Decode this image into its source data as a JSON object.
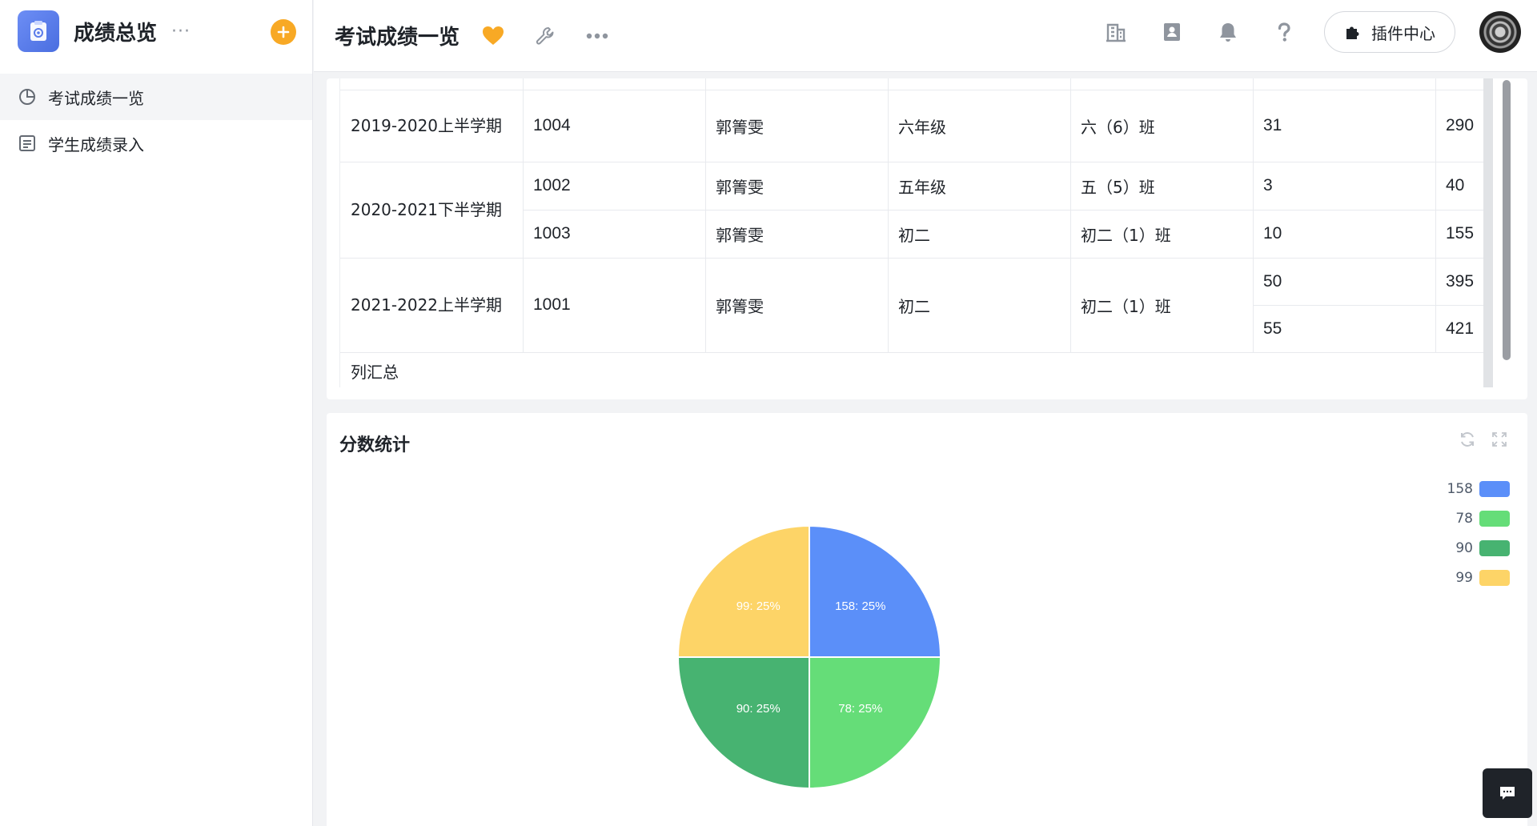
{
  "sidebar": {
    "app_name": "成绩总览",
    "more": "···",
    "items": [
      {
        "label": "考试成绩一览",
        "icon": "clock-pie-icon",
        "active": true
      },
      {
        "label": "学生成绩录入",
        "icon": "form-icon",
        "active": false
      }
    ]
  },
  "topbar": {
    "title": "考试成绩一览",
    "plugin_label": "插件中心"
  },
  "table": {
    "rows": [
      {
        "term": "2019-2020上半学期",
        "id": "1004",
        "name": "郭箐雯",
        "grade": "六年级",
        "class": "六（6）班",
        "v1": "31",
        "v2": "290"
      },
      {
        "term": "2020-2021下半学期",
        "id": "1002",
        "name": "郭箐雯",
        "grade": "五年级",
        "class": "五（5）班",
        "v1": "3",
        "v2": "40"
      },
      {
        "term": "",
        "id": "1003",
        "name": "郭箐雯",
        "grade": "初二",
        "class": "初二（1）班",
        "v1": "10",
        "v2": "155"
      },
      {
        "term": "2021-2022上半学期",
        "id": "1001",
        "name": "郭箐雯",
        "grade": "初二",
        "class": "初二（1）班",
        "v1": "50",
        "v2": "395"
      },
      {
        "term": "",
        "id": "",
        "name": "",
        "grade": "",
        "class": "",
        "v1": "55",
        "v2": "421"
      }
    ],
    "summary_label": "列汇总"
  },
  "chart_card": {
    "title": "分数统计"
  },
  "colors": {
    "accent_orange": "#f8a925",
    "blue": "#5b8ff9",
    "light_green": "#65dd78",
    "green": "#47b371",
    "yellow": "#fdd467"
  },
  "chart_data": {
    "type": "pie",
    "title": "",
    "categories": [
      "158",
      "78",
      "90",
      "99"
    ],
    "values": [
      25,
      25,
      25,
      25
    ],
    "labels": [
      "158: 25%",
      "78: 25%",
      "90: 25%",
      "99: 25%"
    ],
    "colors": [
      "#5b8ff9",
      "#65dd78",
      "#47b371",
      "#fdd467"
    ],
    "legend": "top-right"
  }
}
